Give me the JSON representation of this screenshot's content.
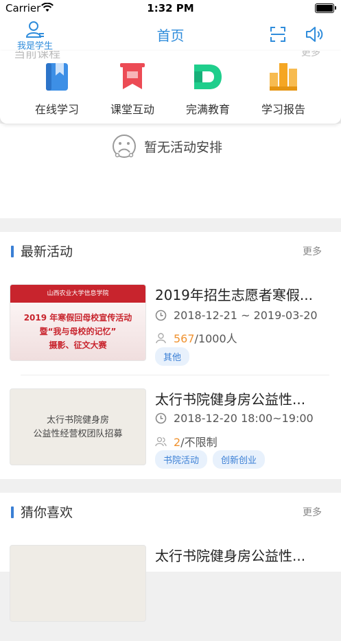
{
  "status_bar": {
    "carrier": "Carrier",
    "time": "1:32 PM"
  },
  "nav": {
    "user_label": "我是学生",
    "title": "首页"
  },
  "top_card": {
    "ghost_title": "当前课程",
    "ghost_more": "更多",
    "features": [
      {
        "label": "在线学习",
        "icon": "bookmark-book-icon",
        "color": "#3d8fe6"
      },
      {
        "label": "课堂互动",
        "icon": "flag-icon",
        "color": "#ec4b55"
      },
      {
        "label": "完满教育",
        "icon": "letter-d-icon",
        "color": "#1fce8c"
      },
      {
        "label": "学习报告",
        "icon": "bar-chart-icon",
        "color": "#f5a623"
      }
    ]
  },
  "empty_state": {
    "text": "暂无活动安排"
  },
  "latest": {
    "title": "最新活动",
    "more": "更多",
    "items": [
      {
        "title": "2019年招生志愿者寒假...",
        "time": "2018-12-21 ~ 2019-03-20",
        "count_current": "567",
        "count_rest": "/1000人",
        "tags": [
          "其他"
        ],
        "thumb_header": "山西农业大学信息学院",
        "thumb_lines": [
          "2019 年寒假回母校宣传活动",
          "暨“我与母校的记忆”",
          "摄影、征文大赛"
        ]
      },
      {
        "title": "太行书院健身房公益性...",
        "time": "2018-12-20  18:00~19:00",
        "count_current": "2",
        "count_rest": "/不限制",
        "tags": [
          "书院活动",
          "创新创业"
        ],
        "thumb_lines": [
          "太行书院健身房",
          "公益性经营权团队招募"
        ]
      }
    ]
  },
  "guess": {
    "title": "猜你喜欢",
    "more": "更多",
    "items": [
      {
        "title": "太行书院健身房公益性..."
      }
    ]
  }
}
